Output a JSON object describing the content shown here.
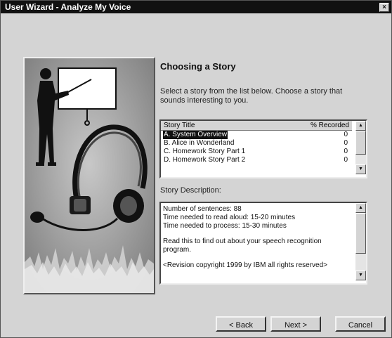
{
  "window": {
    "title": "User Wizard - Analyze My Voice",
    "close_glyph": "×"
  },
  "page": {
    "heading": "Choosing a Story",
    "instructions": "Select a story from the list below. Choose a story that sounds interesting to you."
  },
  "story_list": {
    "col_title": "Story Title",
    "col_recorded": "% Recorded",
    "rows": [
      {
        "title": "A. System Overview",
        "recorded": "0",
        "selected": true
      },
      {
        "title": "B. Alice in Wonderland",
        "recorded": "0",
        "selected": false
      },
      {
        "title": "C. Homework Story Part 1",
        "recorded": "0",
        "selected": false
      },
      {
        "title": "D. Homework Story Part 2",
        "recorded": "0",
        "selected": false
      }
    ],
    "scroll_up_glyph": "▲",
    "scroll_down_glyph": "▼"
  },
  "description": {
    "label": "Story Description:",
    "line1": "Number of sentences: 88",
    "line2": "Time needed to read aloud: 15-20 minutes",
    "line3": "Time needed to process: 15-30  minutes",
    "para2": "Read this to find out about your speech recognition program.",
    "copyright": "<Revision copyright 1999 by IBM  all rights reserved>",
    "scroll_up_glyph": "▲",
    "scroll_down_glyph": "▼"
  },
  "buttons": {
    "back": "< Back",
    "next": "Next >",
    "cancel": "Cancel"
  },
  "icons": {
    "illustration": "presenter-with-headset-illustration"
  }
}
